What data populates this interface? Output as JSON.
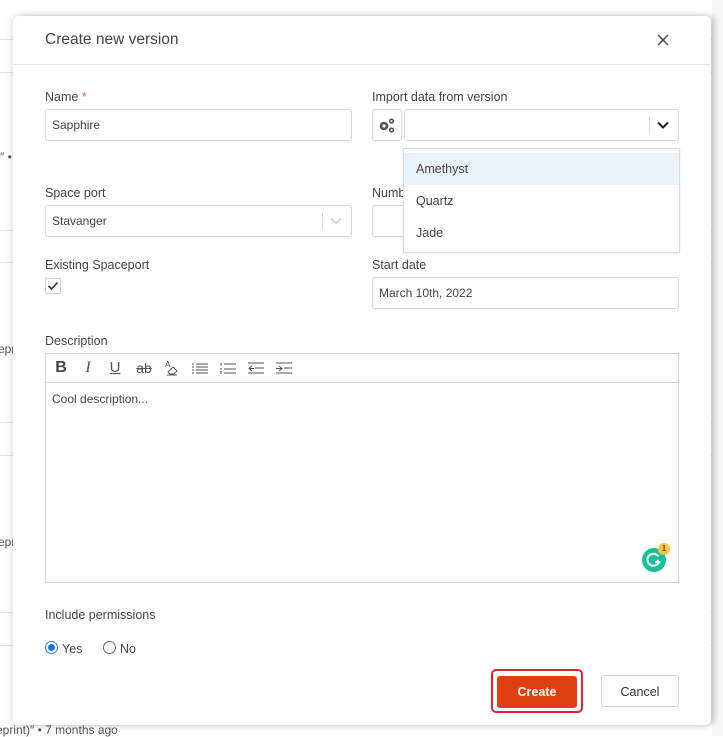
{
  "background": {
    "fragments": [
      "″ •",
      "epr",
      "epr",
      "eprint)″ • 7 months ago"
    ]
  },
  "modal": {
    "title": "Create new version",
    "close_icon": "close-icon",
    "fields": {
      "name": {
        "label": "Name",
        "required_mark": "*",
        "value": "Sapphire"
      },
      "import_version": {
        "label": "Import data from version",
        "value": "",
        "icon": "gears-icon"
      },
      "space_port": {
        "label": "Space port",
        "value": "Stavanger"
      },
      "number": {
        "label": "Numb",
        "value": ""
      },
      "existing_spaceport": {
        "label": "Existing Spaceport",
        "checked": true
      },
      "start_date": {
        "label": "Start date",
        "value": "March 10th, 2022"
      },
      "description": {
        "label": "Description",
        "value": "Cool description...",
        "toolbar": [
          {
            "name": "bold",
            "glyph": "B"
          },
          {
            "name": "italic",
            "glyph": "I"
          },
          {
            "name": "underline",
            "glyph": "U"
          },
          {
            "name": "strikethrough",
            "glyph": "ab"
          },
          {
            "name": "clear-format",
            "glyph": "A"
          },
          {
            "name": "bullet-list",
            "glyph": ""
          },
          {
            "name": "numbered-list",
            "glyph": ""
          },
          {
            "name": "outdent",
            "glyph": ""
          },
          {
            "name": "indent",
            "glyph": ""
          }
        ],
        "grammarly_badge": "1"
      },
      "include_permissions": {
        "label": "Include permissions",
        "options": [
          {
            "label": "Yes",
            "selected": true
          },
          {
            "label": "No",
            "selected": false
          }
        ]
      }
    },
    "dropdown": {
      "options": [
        "Amethyst",
        "Quartz",
        "Jade"
      ],
      "highlighted": "Amethyst"
    },
    "buttons": {
      "create": "Create",
      "cancel": "Cancel"
    },
    "colors": {
      "primary": "#e04010",
      "focus_ring": "#e8212b",
      "radio_selected": "#1e6fe0",
      "dropdown_highlight": "#ebf3fb",
      "grammarly": "#15c39a"
    }
  }
}
